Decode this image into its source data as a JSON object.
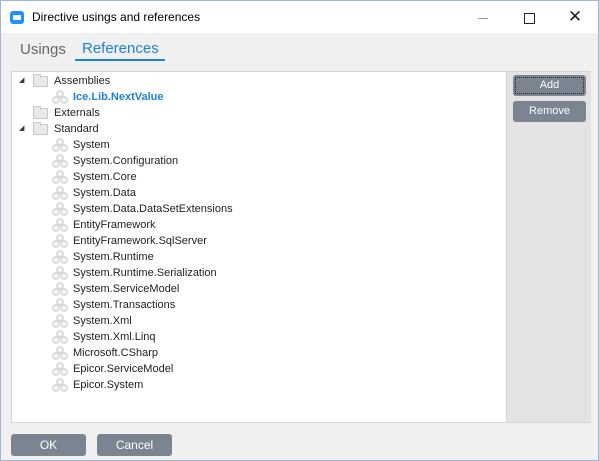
{
  "window": {
    "title": "Directive usings and references",
    "controls": {
      "minimize_icon": "minimize-icon",
      "maximize_icon": "maximize-icon",
      "close_icon": "close-icon",
      "close_glyph": "✕"
    }
  },
  "tabs": [
    {
      "label": "Usings",
      "active": false
    },
    {
      "label": "References",
      "active": true
    }
  ],
  "tree": {
    "groups": [
      {
        "label": "Assemblies",
        "expanded": true,
        "children": [
          {
            "label": "Ice.Lib.NextValue",
            "selected": true
          }
        ]
      },
      {
        "label": "Externals",
        "expanded": false,
        "children": []
      },
      {
        "label": "Standard",
        "expanded": true,
        "children": [
          {
            "label": "System"
          },
          {
            "label": "System.Configuration"
          },
          {
            "label": "System.Core"
          },
          {
            "label": "System.Data"
          },
          {
            "label": "System.Data.DataSetExtensions"
          },
          {
            "label": "EntityFramework"
          },
          {
            "label": "EntityFramework.SqlServer"
          },
          {
            "label": "System.Runtime"
          },
          {
            "label": "System.Runtime.Serialization"
          },
          {
            "label": "System.ServiceModel"
          },
          {
            "label": "System.Transactions"
          },
          {
            "label": "System.Xml"
          },
          {
            "label": "System.Xml.Linq"
          },
          {
            "label": "Microsoft.CSharp"
          },
          {
            "label": "Epicor.ServiceModel"
          },
          {
            "label": "Epicor.System"
          }
        ]
      }
    ]
  },
  "side_buttons": {
    "add_label": "Add",
    "remove_label": "Remove"
  },
  "footer": {
    "ok_label": "OK",
    "cancel_label": "Cancel"
  },
  "colors": {
    "accent": "#1e82d6",
    "button": "#7a8591",
    "panel": "#e3e3e3"
  }
}
